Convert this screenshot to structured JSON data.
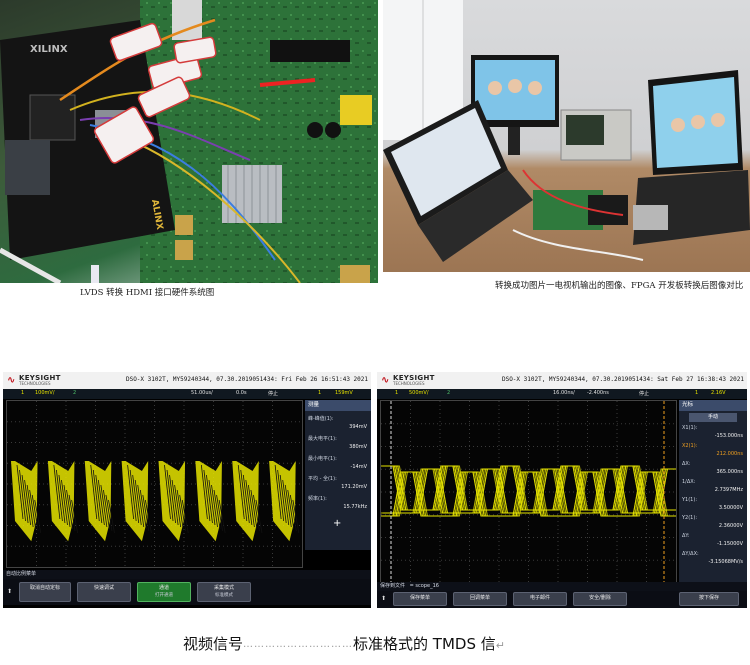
{
  "captions": {
    "left_photo": "LVDS 转换 HDMI 接口硬件系统图",
    "right_photo": "转换成功图片一电视机输出的图像、FPGA 开发板转换后图像对比"
  },
  "board_labels": {
    "alinx": "ALINX",
    "xilinx": "XILINX"
  },
  "scope_left": {
    "brand": "KEYSIGHT",
    "brand_sub": "TECHNOLOGIES",
    "model_line": "DSO-X 3102T, MY59240344, 07.30.2019051434: Fri Feb 26 16:51:43 2021",
    "status": {
      "ch": "1",
      "volts": "100mV/",
      "ch2": "2",
      "time": "51.00us/",
      "offset": "0.0s",
      "mode": "停止",
      "trig": "1",
      "trig_level": "159mV"
    },
    "panel_title": "测量",
    "measurements": [
      {
        "label": "峰-峰值(1):",
        "value": "394mV"
      },
      {
        "label": "最大电平(1):",
        "value": "380mV"
      },
      {
        "label": "最小电平(1):",
        "value": "-14mV"
      },
      {
        "label": "平均 - 全(1):",
        "value": "171.20mV"
      },
      {
        "label": "频率(1):",
        "value": "15.77kHz"
      }
    ],
    "plus_symbol": "+",
    "softkey_title": "自动比例菜单",
    "softkeys": [
      {
        "label": "取消自动定标",
        "sub": ""
      },
      {
        "label": "快速调试",
        "sub": ""
      },
      {
        "label": "通道",
        "sub": "打开通道"
      },
      {
        "label": "采集模式",
        "sub": "标准模式"
      }
    ]
  },
  "scope_right": {
    "brand": "KEYSIGHT",
    "brand_sub": "TECHNOLOGIES",
    "model_line": "DSO-X 3102T, MY59240344, 07.30.2019051434: Sat Feb 27 16:38:43 2021",
    "status": {
      "ch": "1",
      "volts": "500mV/",
      "ch2": "2",
      "time": "16.00ns/",
      "offset": "-2.400ns",
      "mode": "停止",
      "trig": "1",
      "trig_level": "2.16V"
    },
    "panel_title": "光标",
    "mode_label": "手动",
    "cursors": [
      {
        "label": "X1(1):",
        "value": "-153.000ns"
      },
      {
        "label": "X2(1):",
        "value": "212.000ns"
      },
      {
        "label": "ΔX:",
        "value": "365.000ns"
      },
      {
        "label": "1/ΔX:",
        "value": "2.7397MHz"
      },
      {
        "label": "Y1(1):",
        "value": "3.50000V"
      },
      {
        "label": "Y2(1):",
        "value": "2.36000V"
      },
      {
        "label": "ΔY:",
        "value": "-1.15000V"
      },
      {
        "label": "ΔY/ΔX:",
        "value": "-3.15068MV/s"
      }
    ],
    "softkey_title_label": "保存到文件",
    "file_name": "scope_16",
    "softkeys": [
      {
        "label": "保存菜单",
        "sub": ""
      },
      {
        "label": "回调菜单",
        "sub": ""
      },
      {
        "label": "电子邮件",
        "sub": ""
      },
      {
        "label": "安全/删除",
        "sub": ""
      },
      {
        "label": "按下保存",
        "sub": ""
      }
    ]
  },
  "bottom_caption": {
    "left": "视频信号",
    "dots": "…………………………",
    "right": "标准格式的 TMDS 信"
  },
  "colors": {
    "trace": "#e8e500",
    "scope_bg": "#000000",
    "keysight_red": "#c0111a"
  }
}
